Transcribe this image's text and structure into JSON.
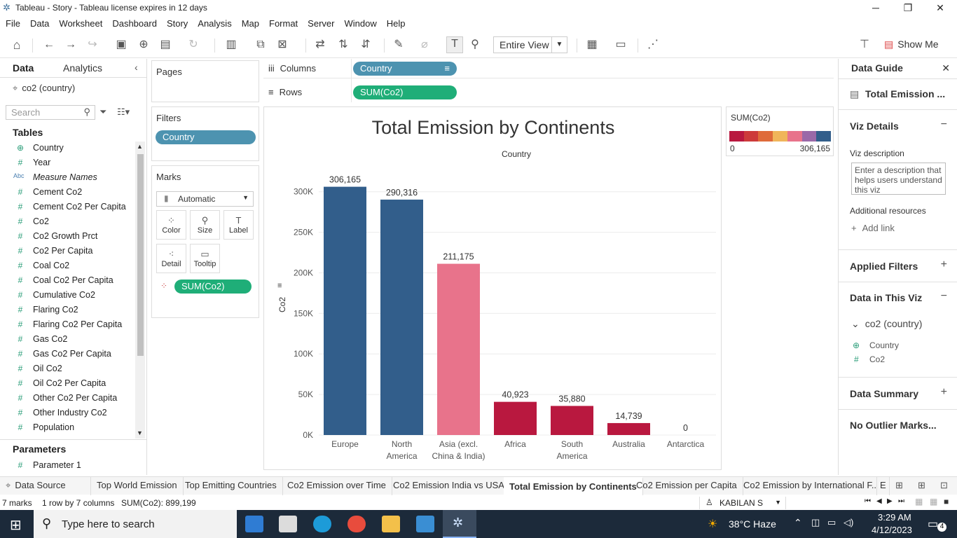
{
  "window": {
    "title": "Tableau - Story - Tableau license expires in 12 days"
  },
  "menu": [
    "File",
    "Data",
    "Worksheet",
    "Dashboard",
    "Story",
    "Analysis",
    "Map",
    "Format",
    "Server",
    "Window",
    "Help"
  ],
  "toolbar": {
    "view": "Entire View",
    "show_me": "Show Me"
  },
  "left": {
    "tabs": [
      "Data",
      "Analytics"
    ],
    "datasource": "co2 (country)",
    "search_placeholder": "Search",
    "tables_label": "Tables",
    "fields": [
      {
        "icon": "globe",
        "name": "Country"
      },
      {
        "icon": "#",
        "name": "Year"
      },
      {
        "icon": "Abc",
        "name": "Measure Names"
      },
      {
        "icon": "#",
        "name": "Cement Co2"
      },
      {
        "icon": "#",
        "name": "Cement Co2 Per Capita"
      },
      {
        "icon": "#",
        "name": "Co2"
      },
      {
        "icon": "#",
        "name": "Co2 Growth Prct"
      },
      {
        "icon": "#",
        "name": "Co2 Per Capita"
      },
      {
        "icon": "#",
        "name": "Coal Co2"
      },
      {
        "icon": "#",
        "name": "Coal Co2 Per Capita"
      },
      {
        "icon": "#",
        "name": "Cumulative Co2"
      },
      {
        "icon": "#",
        "name": "Flaring Co2"
      },
      {
        "icon": "#",
        "name": "Flaring Co2 Per Capita"
      },
      {
        "icon": "#",
        "name": "Gas Co2"
      },
      {
        "icon": "#",
        "name": "Gas Co2 Per Capita"
      },
      {
        "icon": "#",
        "name": "Oil Co2"
      },
      {
        "icon": "#",
        "name": "Oil Co2 Per Capita"
      },
      {
        "icon": "#",
        "name": "Other Co2 Per Capita"
      },
      {
        "icon": "#",
        "name": "Other Industry Co2"
      },
      {
        "icon": "#",
        "name": "Population"
      }
    ],
    "parameters_label": "Parameters",
    "parameters": [
      "Parameter 1"
    ]
  },
  "cards": {
    "pages": "Pages",
    "filters": "Filters",
    "filter_pill": "Country",
    "marks": "Marks",
    "mark_type": "Automatic",
    "mark_buttons": [
      "Color",
      "Size",
      "Label",
      "Detail",
      "Tooltip"
    ],
    "marks_pill": "SUM(Co2)"
  },
  "shelves": {
    "columns_label": "Columns",
    "columns_pill": "Country",
    "rows_label": "Rows",
    "rows_pill": "SUM(Co2)"
  },
  "legend": {
    "title": "SUM(Co2)",
    "min": "0",
    "max": "306,165"
  },
  "chart_data": {
    "type": "bar",
    "title": "Total Emission by Continents",
    "xlabel": "Country",
    "ylabel": "Co2",
    "ylim": [
      0,
      330000
    ],
    "yticks": [
      "0K",
      "50K",
      "100K",
      "150K",
      "200K",
      "250K",
      "300K"
    ],
    "categories": [
      "Europe",
      "North America",
      "Asia (excl. China & India)",
      "Africa",
      "South America",
      "Australia",
      "Antarctica"
    ],
    "category_lines": [
      [
        "Europe"
      ],
      [
        "North",
        "America"
      ],
      [
        "Asia (excl.",
        "China & India)"
      ],
      [
        "Africa"
      ],
      [
        "South",
        "America"
      ],
      [
        "Australia"
      ],
      [
        "Antarctica"
      ]
    ],
    "values": [
      306165,
      290316,
      211175,
      40923,
      35880,
      14739,
      0
    ],
    "labels": [
      "306,165",
      "290,316",
      "211,175",
      "40,923",
      "35,880",
      "14,739",
      "0"
    ],
    "colors": [
      "#325e8b",
      "#325e8b",
      "#e8738b",
      "#b9183f",
      "#b9183f",
      "#b9183f",
      "#b9183f"
    ]
  },
  "guide": {
    "title": "Data Guide",
    "sheet": "Total Emission ...",
    "viz_details": "Viz Details",
    "viz_desc_label": "Viz description",
    "viz_desc_placeholder": "Enter a description that helps users understand this viz",
    "resources": "Additional resources",
    "add_link": "Add link",
    "applied_filters": "Applied Filters",
    "data_in_viz": "Data in This Viz",
    "source": "co2 (country)",
    "fields": [
      "Country",
      "Co2"
    ],
    "summary": "Data Summary",
    "outliers": "No Outlier Marks..."
  },
  "sheet_tabs": [
    "Data Source",
    "Top World Emission",
    "Top Emitting Countries",
    "Co2 Emission over Time",
    "Co2 Emission India vs USA",
    "Total Emission by Continents",
    "Co2 Emission per Capita",
    "Co2 Emission by International F...",
    "E"
  ],
  "status": {
    "marks": "7 marks",
    "dims": "1 row by 7 columns",
    "sum": "SUM(Co2): 899,199",
    "user": "KABILAN S"
  },
  "taskbar": {
    "search": "Type here to search",
    "weather": "38°C  Haze",
    "time": "3:29 AM",
    "date": "4/12/2023",
    "badge": "4"
  }
}
